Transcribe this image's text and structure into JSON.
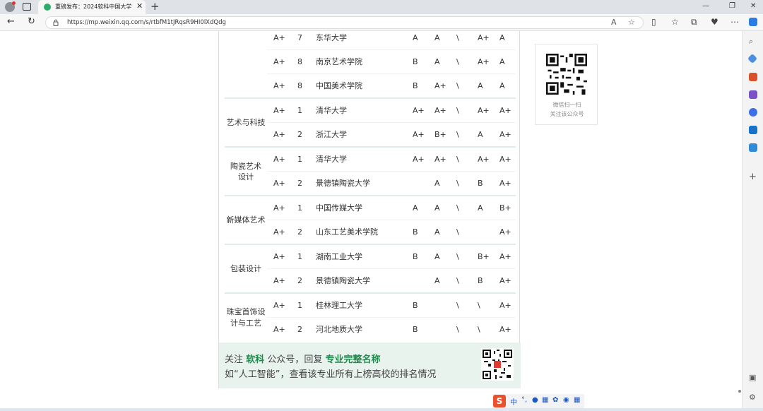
{
  "browser": {
    "tab_title": "重磅发布：2024软科中国大学专",
    "url": "https://mp.weixin.qq.com/s/rtbfM1tJRqsR9HI0lXdQdg"
  },
  "rows": [
    {
      "grade": "A+",
      "rank": "7",
      "school": "东华大学",
      "g1": "A",
      "g2": "A",
      "g3": "\\",
      "g4": "A+",
      "g5": "A"
    },
    {
      "grade": "A+",
      "rank": "8",
      "school": "南京艺术学院",
      "g1": "B",
      "g2": "A",
      "g3": "\\",
      "g4": "A+",
      "g5": "A"
    },
    {
      "grade": "A+",
      "rank": "8",
      "school": "中国美术学院",
      "g1": "B",
      "g2": "A+",
      "g3": "\\",
      "g4": "A",
      "g5": "A"
    },
    {
      "grade": "A+",
      "rank": "1",
      "school": "清华大学",
      "g1": "A+",
      "g2": "A+",
      "g3": "\\",
      "g4": "A+",
      "g5": "A+"
    },
    {
      "grade": "A+",
      "rank": "2",
      "school": "浙江大学",
      "g1": "A+",
      "g2": "B+",
      "g3": "\\",
      "g4": "A",
      "g5": "A+"
    },
    {
      "grade": "A+",
      "rank": "1",
      "school": "清华大学",
      "g1": "A+",
      "g2": "A+",
      "g3": "\\",
      "g4": "A+",
      "g5": "A+"
    },
    {
      "grade": "A+",
      "rank": "2",
      "school": "景德镇陶瓷大学",
      "g1": "",
      "g2": "A",
      "g3": "\\",
      "g4": "B",
      "g5": "A+"
    },
    {
      "grade": "A+",
      "rank": "1",
      "school": "中国传媒大学",
      "g1": "A",
      "g2": "A",
      "g3": "\\",
      "g4": "A",
      "g5": "B+"
    },
    {
      "grade": "A+",
      "rank": "2",
      "school": "山东工艺美术学院",
      "g1": "B",
      "g2": "A",
      "g3": "\\",
      "g4": "",
      "g5": "A+"
    },
    {
      "grade": "A+",
      "rank": "1",
      "school": "湖南工业大学",
      "g1": "B",
      "g2": "A",
      "g3": "\\",
      "g4": "B+",
      "g5": "A+"
    },
    {
      "grade": "A+",
      "rank": "2",
      "school": "景德镇陶瓷大学",
      "g1": "",
      "g2": "A",
      "g3": "\\",
      "g4": "B",
      "g5": "A+"
    },
    {
      "grade": "A+",
      "rank": "1",
      "school": "桂林理工大学",
      "g1": "B",
      "g2": "",
      "g3": "\\",
      "g4": "\\",
      "g5": "A+"
    },
    {
      "grade": "A+",
      "rank": "2",
      "school": "河北地质大学",
      "g1": "B",
      "g2": "",
      "g3": "\\",
      "g4": "\\",
      "g5": "A+"
    }
  ],
  "groups": {
    "art_tech": "艺术与科技",
    "ceramic_l1": "陶瓷艺术",
    "ceramic_l2": "设计",
    "new_media": "新媒体艺术",
    "packaging": "包装设计",
    "jewelry_l1": "珠宝首饰设",
    "jewelry_l2": "计与工艺"
  },
  "footer": {
    "p1": "关注",
    "h1": "软科",
    "p2": "公众号，回复",
    "h2": "专业完整名称",
    "line2": "如“人工智能”，查看该专业所有上榜高校的排名情况"
  },
  "qrcard": {
    "line1": "微信扫一扫",
    "line2": "关注该公众号"
  },
  "ime": {
    "logo": "S",
    "lang": "中"
  }
}
